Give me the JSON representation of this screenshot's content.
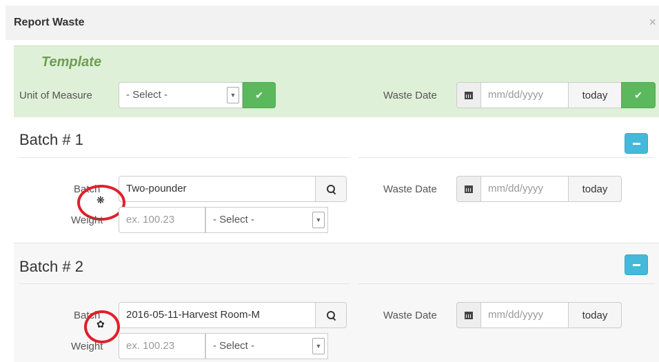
{
  "modal": {
    "title": "Report Waste",
    "close": "×"
  },
  "template": {
    "heading": "Template",
    "unit_label": "Unit of Measure",
    "unit_value": "- Select -",
    "waste_date_label": "Waste Date",
    "date_placeholder": "mm/dd/yyyy",
    "today_label": "today"
  },
  "batches": [
    {
      "title": "Batch # 1",
      "batch_label": "Batch",
      "batch_value": "Two-pounder",
      "weight_label": "Weight",
      "weight_placeholder": "ex. 100.23",
      "unit_value": "- Select -",
      "waste_date_label": "Waste Date",
      "date_placeholder": "mm/dd/yyyy",
      "today_label": "today",
      "marker_glyph": "❋"
    },
    {
      "title": "Batch # 2",
      "batch_label": "Batch",
      "batch_value": "2016-05-11-Harvest Room-M",
      "weight_label": "Weight",
      "weight_placeholder": "ex. 100.23",
      "unit_value": "- Select -",
      "waste_date_label": "Waste Date",
      "date_placeholder": "mm/dd/yyyy",
      "today_label": "today",
      "marker_glyph": "✿"
    }
  ],
  "icons": {
    "check": "✔",
    "remove": "minus-icon",
    "calendar": "calendar-icon",
    "search": "search-icon"
  },
  "colors": {
    "template_bg": "#dff0d8",
    "success": "#5cb85c",
    "info": "#46b8da",
    "annotation_red": "#e0202a"
  }
}
